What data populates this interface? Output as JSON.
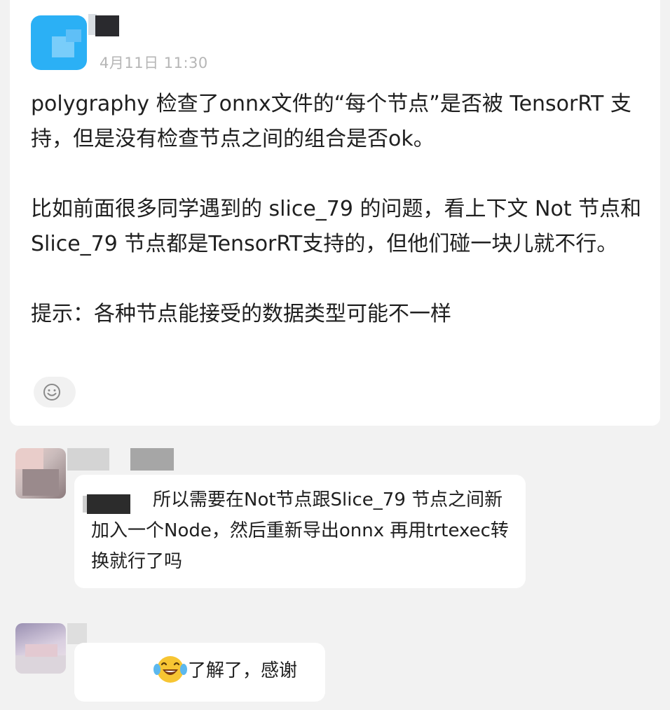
{
  "post": {
    "time": "4月11日 11:30",
    "paragraphs": [
      "polygraphy 检查了onnx文件的“每个节点”是否被 TensorRT 支持，但是没有检查节点之间的组合是否ok。",
      "比如前面很多同学遇到的 slice_79 的问题，看上下文 Not 节点和 Slice_79 节点都是TensorRT支持的，但他们碰一块儿就不行。",
      "提示：各种节点能接受的数据类型可能不一样"
    ],
    "reaction_icon": "smile-icon",
    "avatar_color": "#2bb0f5"
  },
  "replies": [
    {
      "text": "所以需要在Not节点跟Slice_79 节点之间新加入一个Node，然后重新导出onnx 再用trtexec转换就行了吗"
    },
    {
      "emoji": "laughing-tears-icon",
      "text": "了解了，感谢"
    }
  ]
}
